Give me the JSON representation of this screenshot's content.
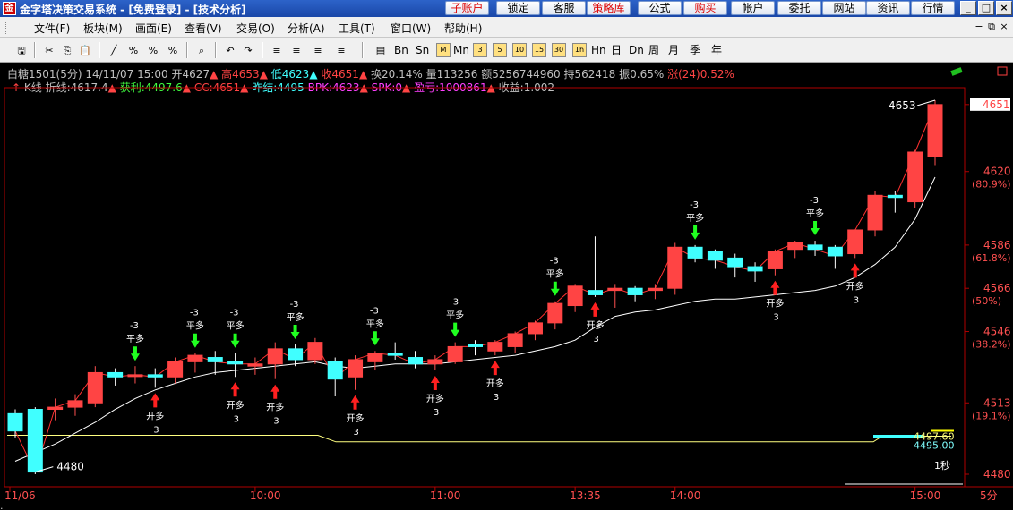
{
  "window": {
    "title": "金字塔决策交易系统 - [免费登录] - [技术分析]",
    "title_buttons": [
      "子账户",
      "锁定",
      "客服",
      "策略库",
      "公式",
      "购买",
      "帐户",
      "委托",
      "网站",
      "资讯",
      "行情"
    ],
    "red_buttons": [
      "子账户",
      "策略库",
      "购买"
    ]
  },
  "menu": {
    "items": [
      "文件(F)",
      "板块(M)",
      "画面(E)",
      "查看(V)",
      "交易(O)",
      "分析(A)",
      "工具(T)",
      "窗口(W)",
      "帮助(H)"
    ]
  },
  "toolbar": {
    "periods": [
      "Bn",
      "Sn",
      "M",
      "Mn",
      "3",
      "5",
      "10",
      "15",
      "30",
      "1h",
      "Hn",
      "日",
      "Dn",
      "周",
      "月",
      "季",
      "年"
    ],
    "selected_period": "5"
  },
  "quote": {
    "symbol": "白糖1501",
    "period": "(5分)",
    "datetime": "14/11/07 15:00",
    "open_label": "开",
    "open": "4627",
    "high_label": "高",
    "high": "4653",
    "low_label": "低",
    "low": "4623",
    "close_label": "收",
    "close": "4651",
    "turnover_label": "换",
    "turnover": "20.14%",
    "volume_label": "量",
    "volume": "113256",
    "amount_label": "额",
    "amount": "5256744960",
    "oi_label": "持",
    "oi": "562418",
    "amplitude_label": "振",
    "amplitude": "0.65%",
    "change_label": "涨",
    "change": "(24)0.52%"
  },
  "indicators": {
    "kline": "K线",
    "zhexian": "折线:4617.4",
    "huoli": "获利:4497.6",
    "cc": "CC:4651",
    "zuojie": "昨结:4495",
    "bpk": "BPK:4623",
    "spk": "SPK:0",
    "yingkui": "盈亏:1000861",
    "shouyi": "收益:1.002"
  },
  "axis": {
    "price_ticks": [
      {
        "price": 4651,
        "label": "4651",
        "pct": ""
      },
      {
        "price": 4620,
        "label": "4620",
        "pct": "(80.9%)"
      },
      {
        "price": 4586,
        "label": "4586",
        "pct": "(61.8%)"
      },
      {
        "price": 4566,
        "label": "4566",
        "pct": "(50%)"
      },
      {
        "price": 4546,
        "label": "4546",
        "pct": "(38.2%)"
      },
      {
        "price": 4513,
        "label": "4513",
        "pct": "(19.1%)"
      },
      {
        "price": 4480,
        "label": "4480",
        "pct": ""
      }
    ],
    "time_labels": [
      {
        "bar": 0,
        "label": "11/06"
      },
      {
        "bar": 12,
        "label": "10:00"
      },
      {
        "bar": 21,
        "label": "11:00"
      },
      {
        "bar": 28,
        "label": "13:35"
      },
      {
        "bar": 33,
        "label": "14:00"
      },
      {
        "bar": 45,
        "label": "15:00"
      }
    ],
    "period_label": "5分",
    "high_marker": "4653",
    "low_marker": "4480",
    "profit_value": "4497.60",
    "yesterday_value": "4495.00",
    "timer": "1秒"
  },
  "signals": {
    "open_long": "开多",
    "close_long": "平多",
    "open_qty": "3",
    "close_qty": "-3"
  },
  "colors": {
    "up": "#ff4444",
    "down": "#40ffff",
    "line": "#ffffff",
    "profit": "#ffff80",
    "buy_arrow": "#ff2020",
    "sell_arrow": "#20ff20"
  },
  "chart_data": {
    "type": "candlestick",
    "title": "白糖1501 (5分)",
    "ylim": [
      4480,
      4653
    ],
    "candles": [
      [
        4508,
        4510,
        4497,
        4500
      ],
      [
        4510,
        4511,
        4480,
        4481
      ],
      [
        4510,
        4515,
        4505,
        4511
      ],
      [
        4511,
        4517,
        4507,
        4514
      ],
      [
        4513,
        4530,
        4511,
        4527
      ],
      [
        4527,
        4529,
        4521,
        4525
      ],
      [
        4526,
        4530,
        4522,
        4526
      ],
      [
        4526,
        4529,
        4520,
        4525
      ],
      [
        4525,
        4534,
        4522,
        4532
      ],
      [
        4532,
        4536,
        4527,
        4535
      ],
      [
        4534,
        4537,
        4526,
        4532
      ],
      [
        4532,
        4536,
        4525,
        4531
      ],
      [
        4530,
        4534,
        4526,
        4531
      ],
      [
        4531,
        4541,
        4524,
        4538
      ],
      [
        4538,
        4540,
        4530,
        4533
      ],
      [
        4533,
        4543,
        4531,
        4541
      ],
      [
        4532,
        4534,
        4516,
        4524
      ],
      [
        4525,
        4535,
        4519,
        4533
      ],
      [
        4532,
        4537,
        4528,
        4536
      ],
      [
        4536,
        4541,
        4533,
        4535
      ],
      [
        4534,
        4537,
        4529,
        4531
      ],
      [
        4531,
        4535,
        4528,
        4533
      ],
      [
        4532,
        4541,
        4531,
        4539
      ],
      [
        4540,
        4542,
        4535,
        4539
      ],
      [
        4537,
        4542,
        4535,
        4541
      ],
      [
        4539,
        4546,
        4536,
        4545
      ],
      [
        4545,
        4551,
        4542,
        4550
      ],
      [
        4550,
        4560,
        4547,
        4559
      ],
      [
        4558,
        4568,
        4555,
        4567
      ],
      [
        4565,
        4590,
        4562,
        4563
      ],
      [
        4565,
        4568,
        4557,
        4566
      ],
      [
        4566,
        4567,
        4560,
        4563
      ],
      [
        4565,
        4568,
        4561,
        4566
      ],
      [
        4566,
        4587,
        4563,
        4585
      ],
      [
        4585,
        4586,
        4578,
        4580
      ],
      [
        4583,
        4584,
        4575,
        4579
      ],
      [
        4580,
        4582,
        4571,
        4576
      ],
      [
        4576,
        4578,
        4569,
        4574
      ],
      [
        4575,
        4584,
        4572,
        4583
      ],
      [
        4584,
        4588,
        4580,
        4587
      ],
      [
        4586,
        4588,
        4581,
        4584
      ],
      [
        4585,
        4586,
        4575,
        4581
      ],
      [
        4582,
        4593,
        4580,
        4593
      ],
      [
        4593,
        4611,
        4590,
        4609
      ],
      [
        4609,
        4611,
        4601,
        4608
      ],
      [
        4606,
        4630,
        4603,
        4629
      ],
      [
        4627,
        4653,
        4623,
        4651
      ]
    ],
    "zhexian_line": [
      4486,
      4490,
      4494,
      4499,
      4504,
      4510,
      4515,
      4519,
      4522,
      4525,
      4527,
      4528,
      4529,
      4530,
      4531,
      4532,
      4530,
      4529,
      4530,
      4531,
      4531,
      4531,
      4532,
      4533,
      4534,
      4535,
      4537,
      4539,
      4542,
      4548,
      4553,
      4555,
      4556,
      4558,
      4560,
      4561,
      4561,
      4562,
      4563,
      4564,
      4565,
      4567,
      4571,
      4577,
      4585,
      4598,
      4617.4
    ],
    "huoli_line": [
      4497.6,
      4497.6,
      4497.6,
      4497.6,
      4497.6,
      4497.6,
      4497.6,
      4497.6,
      4497.6,
      4497.6,
      4497.6,
      4497.6,
      4497.6,
      4497.6,
      4497.6,
      4497.6,
      4497.6,
      4497.6,
      4497.6,
      4497.6,
      4497.6,
      4497.6,
      4497.6,
      4497.6,
      4497.6,
      4497.6,
      4497.6,
      4497.6,
      4497.6,
      4497.6,
      4497.6,
      4497.6,
      4497.6,
      4497.6,
      4497.6,
      4497.6,
      4497.6,
      4497.6,
      4497.6,
      4497.6,
      4497.6,
      4497.6,
      4500,
      4500,
      4498,
      4497.6,
      4497.6
    ],
    "buy_signals": [
      7,
      11,
      13,
      17,
      21,
      24,
      29,
      38,
      42
    ],
    "sell_signals": [
      6,
      9,
      11,
      14,
      18,
      22,
      27,
      34,
      40
    ]
  }
}
